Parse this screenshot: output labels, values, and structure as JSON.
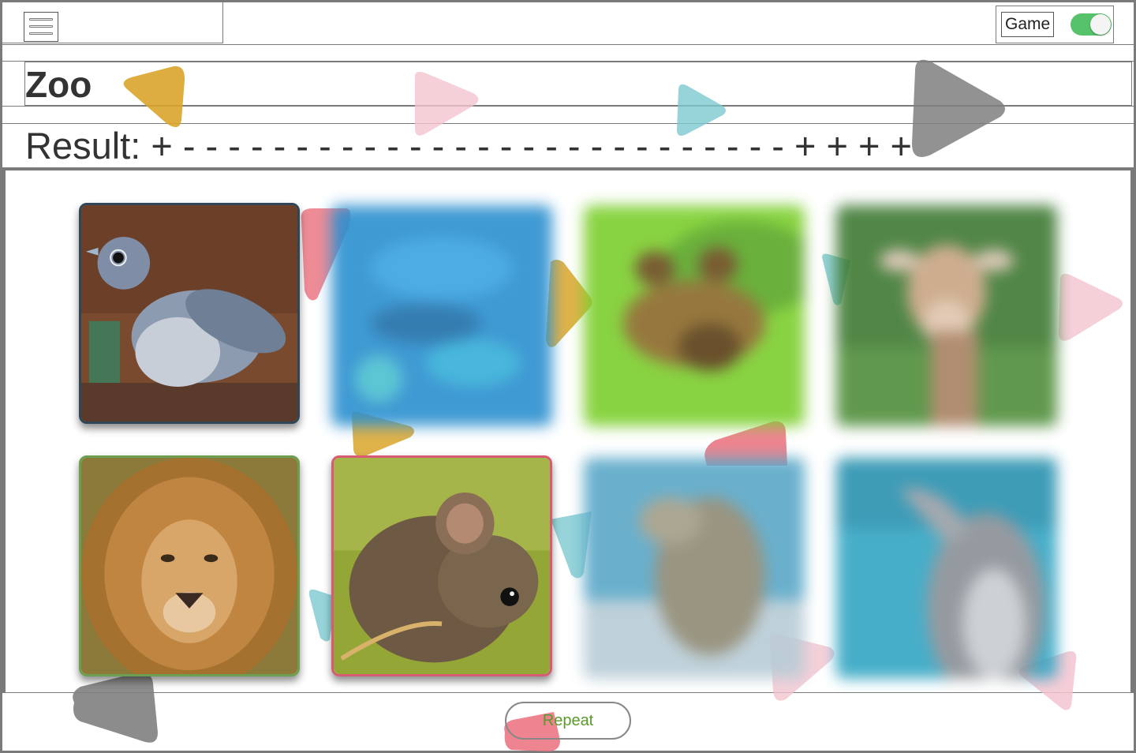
{
  "header": {
    "menu_icon": "hamburger-icon",
    "game_label": "Game",
    "game_toggle_on": true
  },
  "page": {
    "title": "Zoo",
    "result_label": "Result:",
    "result_value": "+ - - - - - - - - - - - - - - - - - - - - - - - - - - - + + + +"
  },
  "cards": [
    {
      "animal": "bird",
      "state": "open"
    },
    {
      "animal": "fish",
      "state": "hidden"
    },
    {
      "animal": "frog",
      "state": "hidden"
    },
    {
      "animal": "giraffe",
      "state": "hidden"
    },
    {
      "animal": "lion",
      "state": "open"
    },
    {
      "animal": "mouse",
      "state": "open"
    },
    {
      "animal": "crocodile",
      "state": "hidden"
    },
    {
      "animal": "dolphin",
      "state": "hidden"
    }
  ],
  "footer": {
    "repeat_label": "Repeat"
  },
  "colors": {
    "toggle_on": "#56c26b",
    "repeat_text": "#5a9a2b",
    "decor_yellow": "#d9a52a",
    "decor_pink": "#f3b7c6",
    "decor_teal": "#7cc9d0",
    "decor_gray": "#7f7f7f",
    "decor_red": "#ea6f7c"
  }
}
